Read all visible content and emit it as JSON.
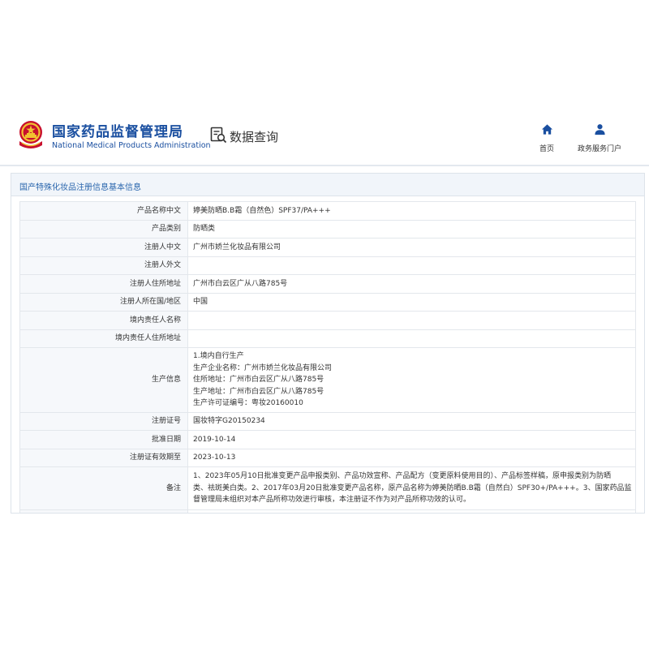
{
  "header": {
    "brand_cn": "国家药品监督管理局",
    "brand_en": "National Medical Products Administration",
    "data_query": "数据查询",
    "nav": [
      {
        "label": "首页",
        "icon": "home-icon"
      },
      {
        "label": "政务服务门户",
        "icon": "user-icon"
      }
    ]
  },
  "panel": {
    "title": "国产特殊化妆品注册信息基本信息"
  },
  "info": {
    "product_cn": {
      "label": "产品名称中文",
      "value": "婷美防晒B.B霜（自然色）SPF37/PA+++"
    },
    "category": {
      "label": "产品类别",
      "value": "防晒类"
    },
    "registrant_cn": {
      "label": "注册人中文",
      "value": "广州市娇兰化妆品有限公司"
    },
    "registrant_en": {
      "label": "注册人外文",
      "value": ""
    },
    "registrant_address": {
      "label": "注册人住所地址",
      "value": "广州市白云区广从八路785号"
    },
    "registrant_country": {
      "label": "注册人所在国/地区",
      "value": "中国"
    },
    "domestic_person": {
      "label": "境内责任人名称",
      "value": ""
    },
    "domestic_address": {
      "label": "境内责任人住所地址",
      "value": ""
    },
    "production": {
      "label": "生产信息",
      "lines": [
        "1.境内自行生产",
        "生产企业名称：广州市娇兰化妆品有限公司",
        "住所地址：广州市白云区广从八路785号",
        "生产地址：广州市白云区广从八路785号",
        "生产许可证编号：粤妆20160010"
      ]
    },
    "reg_no": {
      "label": "注册证号",
      "value": "国妆特字G20150234"
    },
    "approval_date": {
      "label": "批准日期",
      "value": "2019-10-14"
    },
    "valid_until": {
      "label": "注册证有效期至",
      "value": "2023-10-13"
    },
    "remark": {
      "label": "备注",
      "lines": [
        "1、2023年05月10日批准变更产品申报类别、产品功效宣称、产品配方（变更原料使用目的）、产品标签样稿，原申报类别为防晒",
        "类、祛斑美白类。2、2017年03月20日批准变更产品名称，原产品名称为婷美防晒B.B霜（自然白）SPF30+/PA+++。3、国家药品监",
        "督管理局未组织对本产品所称功效进行审核，本注册证不作为对产品所称功效的认可。"
      ]
    }
  },
  "colors": {
    "brand_blue": "#1a4fa0",
    "panel_title": "#2a66ad",
    "label_bg": "#f6f8fb",
    "border": "#e3e7ec"
  }
}
